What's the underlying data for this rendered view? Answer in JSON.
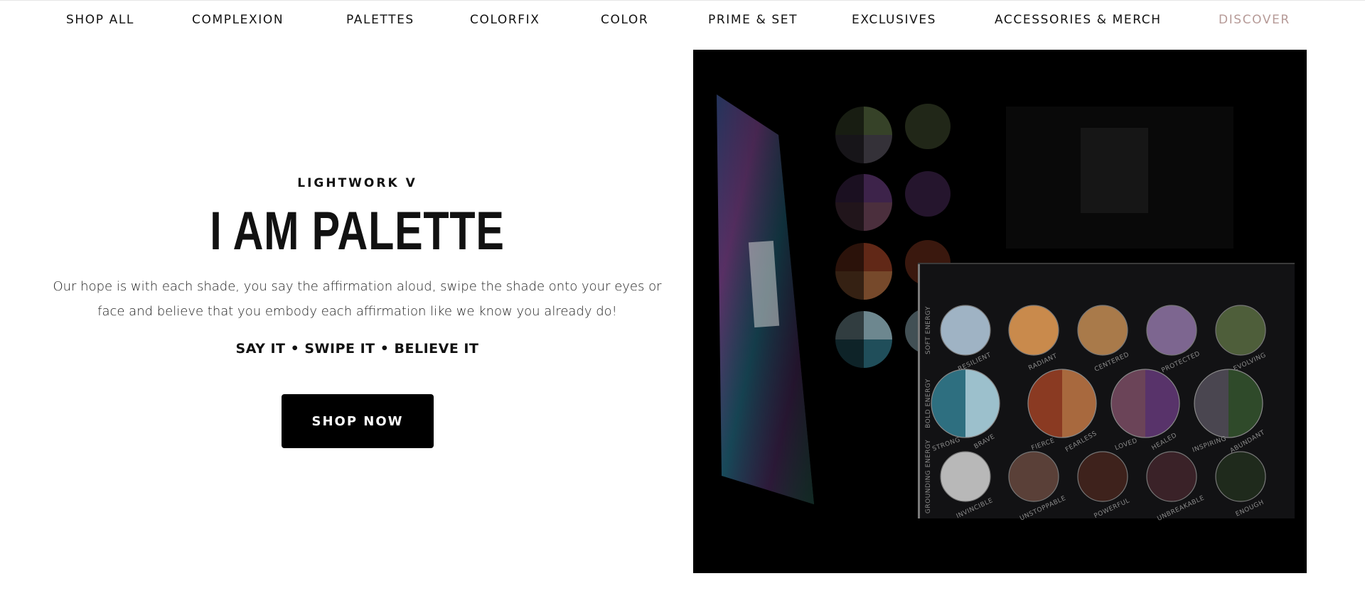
{
  "nav": {
    "items": [
      {
        "label": "SHOP ALL"
      },
      {
        "label": "COMPLEXION"
      },
      {
        "label": "PALETTES"
      },
      {
        "label": "COLORFIX"
      },
      {
        "label": "COLOR"
      },
      {
        "label": "PRIME & SET"
      },
      {
        "label": "EXCLUSIVES"
      },
      {
        "label": "ACCESSORIES & MERCH"
      },
      {
        "label": "DISCOVER"
      }
    ],
    "discover_color": "#b69a97"
  },
  "hero": {
    "eyebrow": "LIGHTWORK V",
    "title": "I AM PALETTE",
    "description": "Our hope is with each shade, you say the affirmation aloud, swipe the shade onto your eyes or face and believe that you embody each affirmation like we know you already do!",
    "tagline": "SAY IT • SWIPE IT • BELIEVE IT",
    "cta_label": "SHOP NOW"
  },
  "palette_image": {
    "rows": [
      {
        "label": "SOFT ENERGY",
        "pans": [
          {
            "name": "RESILIENT",
            "color": "#9fb3c4"
          },
          {
            "name": "RADIANT",
            "color": "#c98a4c"
          },
          {
            "name": "CENTERED",
            "color": "#a97a4a"
          },
          {
            "name": "PROTECTED",
            "color": "#7d6690"
          },
          {
            "name": "EVOLVING",
            "color": "#4e5e3a"
          }
        ]
      },
      {
        "label": "BOLD ENERGY",
        "pans": [
          {
            "name": "STRONG",
            "color": "#2e6f80"
          },
          {
            "name": "BRAVE",
            "color": "#9cc0cc"
          },
          {
            "name": "FIERCE",
            "color": "#8a3a22"
          },
          {
            "name": "FEARLESS",
            "color": "#a8693e"
          },
          {
            "name": "LOVED",
            "color": "#6b4458"
          },
          {
            "name": "HEALED",
            "color": "#58336a"
          },
          {
            "name": "INSPIRING",
            "color": "#4a4650"
          },
          {
            "name": "ABUNDANT",
            "color": "#2f4a2a"
          }
        ]
      },
      {
        "label": "GROUNDING ENERGY",
        "pans": [
          {
            "name": "INVINCIBLE",
            "color": "#b8b8b8"
          },
          {
            "name": "UNSTOPPABLE",
            "color": "#5a4038"
          },
          {
            "name": "POWERFUL",
            "color": "#3e221c"
          },
          {
            "name": "UNBREAKABLE",
            "color": "#3a2228"
          },
          {
            "name": "ENOUGH",
            "color": "#1f2a1c"
          }
        ]
      }
    ],
    "accent_labels": {
      "LOVED": "#4fb3d4",
      "POWERFUL": "#d4a23a"
    }
  }
}
